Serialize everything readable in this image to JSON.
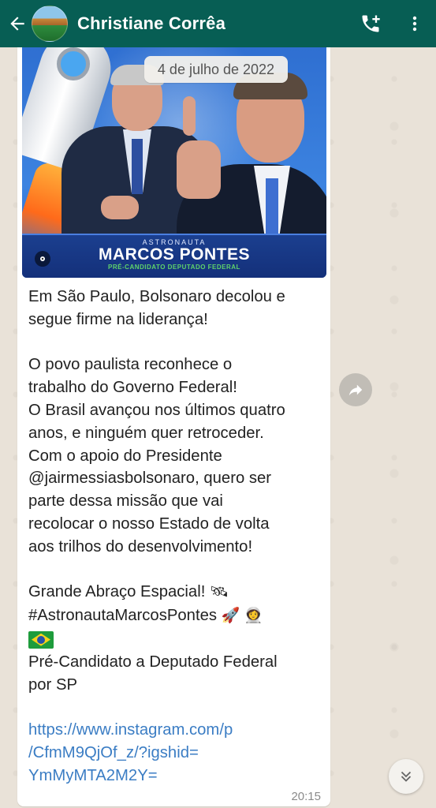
{
  "header": {
    "contact_name": "Christiane Corrêa",
    "back_icon": "arrow-left-icon",
    "call_icon": "add-call-icon",
    "menu_icon": "more-vertical-icon"
  },
  "date_chip": "4 de julho de 2022",
  "media": {
    "banner_top": "ASTRONAUTA",
    "banner_name_1": "MARCOS ",
    "banner_name_2": "PONTES",
    "banner_sub": "PRÉ-CANDIDATO DEPUTADO FEDERAL"
  },
  "message": {
    "paragraph1": [
      "Em São Paulo, Bolsonaro decolou e",
      "segue firme na liderança!"
    ],
    "paragraph2": [
      "O povo paulista reconhece o",
      "trabalho do Governo Federal!",
      "O Brasil avançou nos últimos quatro",
      "anos, e ninguém quer retroceder.",
      "Com o apoio do Presidente",
      "@jairmessiasbolsonaro, quero ser",
      "parte dessa missão que vai",
      "recolocar o nosso Estado de volta",
      "aos trilhos do desenvolvimento!"
    ],
    "signoff_line1": "Grande Abraço Espacial!",
    "signoff_line1_emoji": "🛰",
    "hashtag": "#AstronautaMarcosPontes",
    "hashtag_emojis": "🚀 👩‍🚀",
    "candidate_line1": "Pré-Candidato a Deputado Federal",
    "candidate_line2": "por SP",
    "link_lines": [
      "https://www.instagram.com/p",
      "/CfmM9QjOf_z/?igshid=",
      "YmMyMTA2M2Y="
    ],
    "time": "20:15"
  },
  "colors": {
    "header_bg": "#075e54",
    "link": "#3b7dc4",
    "bubble_bg": "#ffffff"
  }
}
